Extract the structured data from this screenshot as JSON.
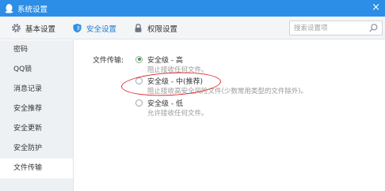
{
  "window": {
    "title": "系统设置",
    "close_glyph": "×"
  },
  "toolbar": {
    "tabs": [
      {
        "label": "基本设置",
        "icon": "gear-icon"
      },
      {
        "label": "安全设置",
        "icon": "shield-icon"
      },
      {
        "label": "权限设置",
        "icon": "lock-icon"
      }
    ],
    "active_tab": 1,
    "search_placeholder": "搜索设置项"
  },
  "sidebar": {
    "items": [
      {
        "label": "密码"
      },
      {
        "label": "QQ锁"
      },
      {
        "label": "消息记录"
      },
      {
        "label": "安全推荐"
      },
      {
        "label": "安全更新"
      },
      {
        "label": "安全防护"
      },
      {
        "label": "文件传输"
      }
    ],
    "active_index": 6
  },
  "file_transfer": {
    "label": "文件传输:",
    "options": [
      {
        "title": "安全级 - 高",
        "desc": "阻止接收任何文件。",
        "checked": true
      },
      {
        "title": "安全级 - 中(推荐)",
        "desc": "阻止接收高安全风险文件(少数常用类型的文件除外)。",
        "checked": false
      },
      {
        "title": "安全级 - 低",
        "desc": "允许接收任何文件。",
        "checked": false
      }
    ]
  },
  "colors": {
    "titlebar": "#2c8ee6",
    "accent": "#1e7ed6",
    "annotation": "#e0262b",
    "radio_checked": "#37a03c"
  }
}
